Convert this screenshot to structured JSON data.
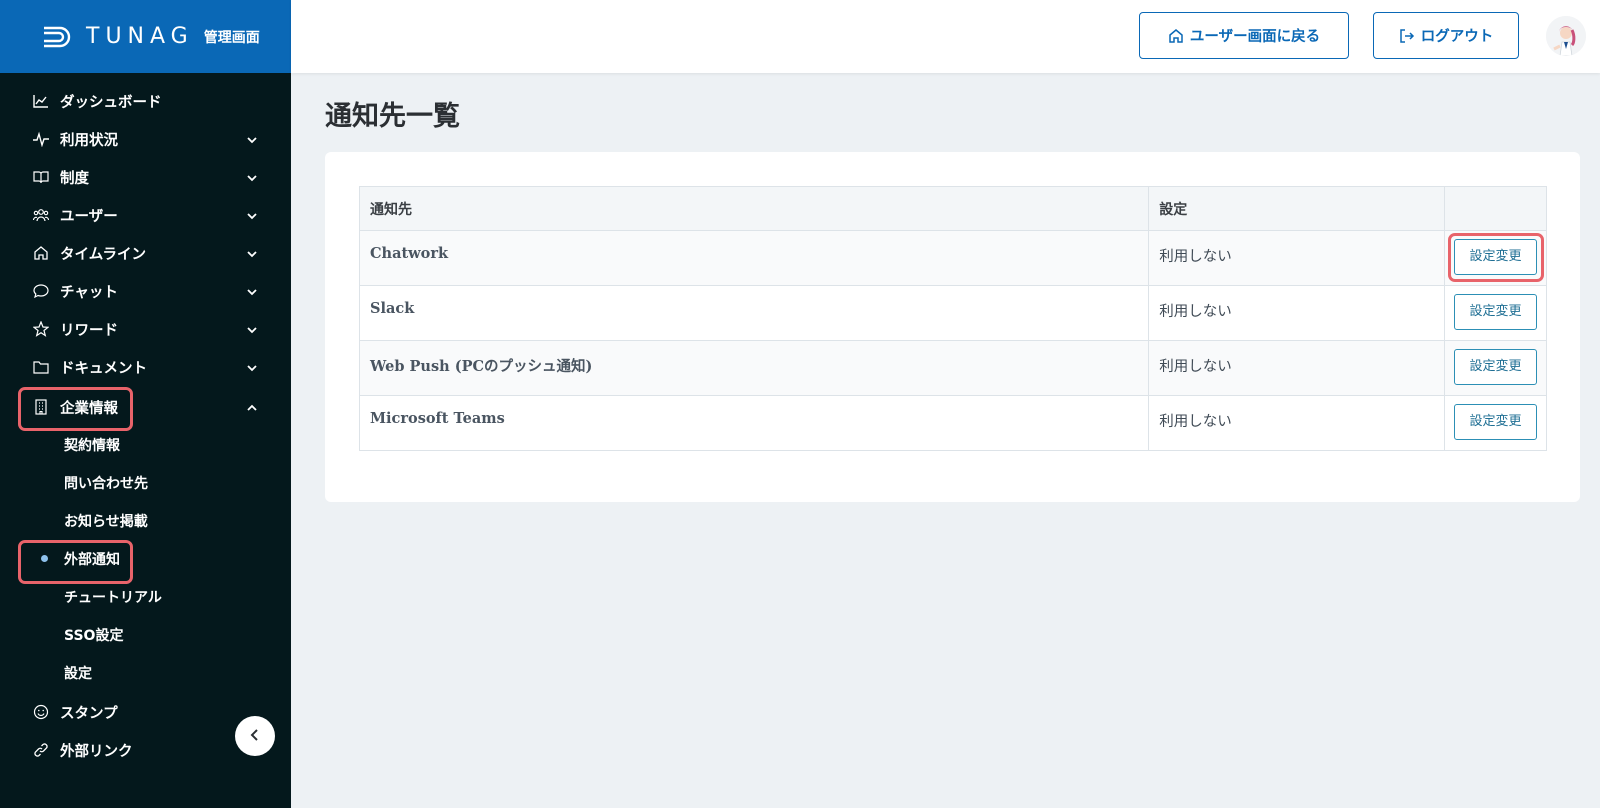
{
  "brand": {
    "name": "TUNAG",
    "subtitle": "管理画面"
  },
  "sidebar": {
    "items": [
      {
        "label": "ダッシュボード",
        "icon": "chart-icon",
        "expandable": false
      },
      {
        "label": "利用状況",
        "icon": "pulse-icon",
        "expandable": true
      },
      {
        "label": "制度",
        "icon": "book-icon",
        "expandable": true
      },
      {
        "label": "ユーザー",
        "icon": "users-icon",
        "expandable": true
      },
      {
        "label": "タイムライン",
        "icon": "home-icon",
        "expandable": true
      },
      {
        "label": "チャット",
        "icon": "chat-icon",
        "expandable": true
      },
      {
        "label": "リワード",
        "icon": "star-icon",
        "expandable": true
      },
      {
        "label": "ドキュメント",
        "icon": "folder-icon",
        "expandable": true
      },
      {
        "label": "企業情報",
        "icon": "building-icon",
        "expandable": true,
        "expanded": true
      },
      {
        "label": "スタンプ",
        "icon": "smiley-icon",
        "expandable": false
      },
      {
        "label": "外部リンク",
        "icon": "link-icon",
        "expandable": false
      }
    ],
    "company_sub_items": [
      {
        "label": "契約情報"
      },
      {
        "label": "問い合わせ先"
      },
      {
        "label": "お知らせ掲載"
      },
      {
        "label": "外部通知",
        "active": true
      },
      {
        "label": "チュートリアル"
      },
      {
        "label": "SSO設定"
      },
      {
        "label": "設定"
      }
    ]
  },
  "header": {
    "back_to_user_label": "ユーザー画面に戻る",
    "logout_label": "ログアウト"
  },
  "main": {
    "title": "通知先一覧",
    "table": {
      "columns": [
        "通知先",
        "設定",
        ""
      ],
      "rows": [
        {
          "name": "Chatwork",
          "setting": "利用しない",
          "action": "設定変更"
        },
        {
          "name": "Slack",
          "setting": "利用しない",
          "action": "設定変更"
        },
        {
          "name": "Web Push (PCのプッシュ通知)",
          "setting": "利用しない",
          "action": "設定変更"
        },
        {
          "name": "Microsoft Teams",
          "setting": "利用しない",
          "action": "設定変更"
        }
      ]
    }
  },
  "colors": {
    "brand_blue": "#0a68b6",
    "sidebar_bg": "#04181c",
    "highlight": "#e8636a",
    "page_bg": "#edf1f4"
  }
}
